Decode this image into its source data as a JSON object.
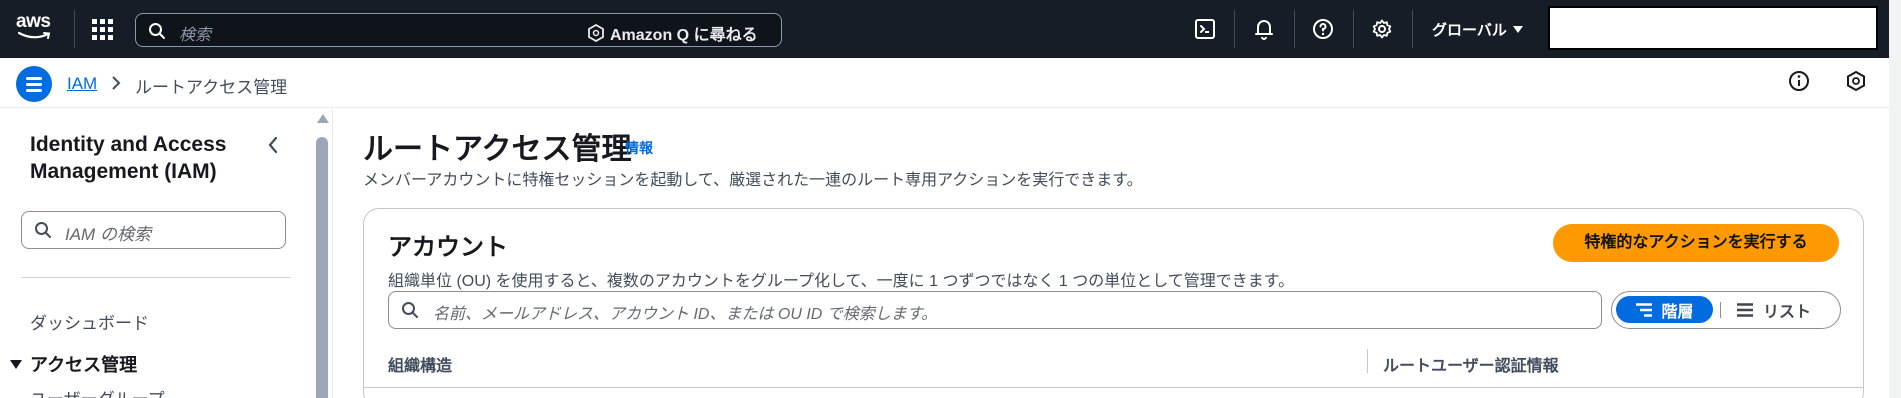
{
  "topnav": {
    "logo": "aws",
    "search_placeholder": "検索",
    "amazon_q_label": "Amazon Q に尋ねる",
    "icons": [
      "apps-grid-icon",
      "search-icon",
      "cloudshell-icon",
      "bell-icon",
      "help-icon",
      "gear-icon"
    ],
    "region": "グローバル"
  },
  "breadcrumb": {
    "items": [
      {
        "label": "IAM",
        "link": true
      },
      {
        "label": "ルートアクセス管理",
        "link": false
      }
    ]
  },
  "sidebar": {
    "title": "Identity and Access Management (IAM)",
    "search_placeholder": "IAM の検索",
    "items": [
      {
        "label": "ダッシュボード"
      },
      {
        "label": "アクセス管理",
        "section": true,
        "expanded": true
      },
      {
        "label": "ユーザーグループ"
      }
    ]
  },
  "main": {
    "title": "ルートアクセス管理",
    "info_link": "情報",
    "description": "メンバーアカウントに特権セッションを起動して、厳選された一連のルート専用アクションを実行できます。",
    "card": {
      "title": "アカウント",
      "primary_button": "特権的なアクションを実行する",
      "description": "組織単位 (OU) を使用すると、複数のアカウントをグループ化して、一度に 1 つずつではなく 1 つの単位として管理できます。",
      "search_placeholder": "名前、メールアドレス、アカウント ID、または OU ID で検索します。",
      "view_toggle": {
        "selected": "階層",
        "other": "リスト"
      },
      "columns": [
        "組織構造",
        "ルートユーザー認証情報"
      ]
    }
  },
  "colors": {
    "nav_bg": "#161d26",
    "link": "#006ce0",
    "primary_button": "#ff9900",
    "text": "#16191f"
  }
}
